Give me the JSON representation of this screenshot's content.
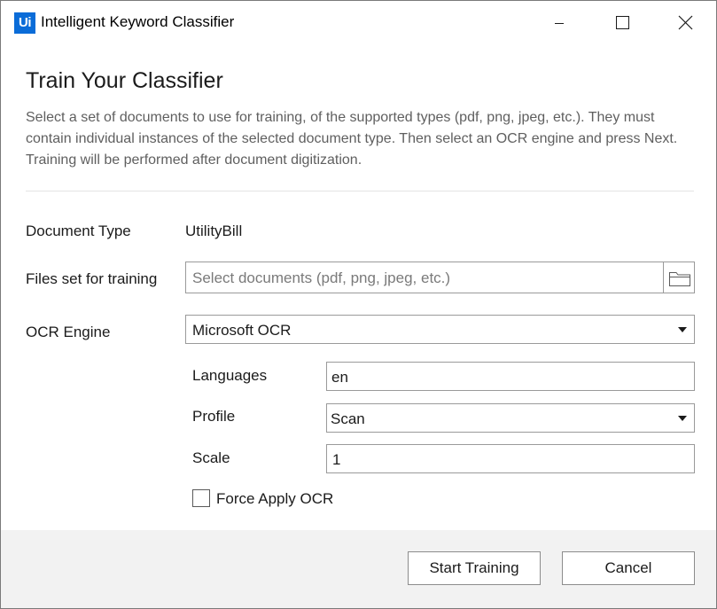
{
  "window": {
    "logo_text": "Ui",
    "title": "Intelligent Keyword Classifier"
  },
  "header": {
    "heading": "Train Your Classifier",
    "description": "Select a set of documents to use for training, of the supported types (pdf, png, jpeg, etc.). They must contain individual instances of the selected document type. Then select an OCR engine and press Next. Training will be performed after document digitization."
  },
  "form": {
    "document_type": {
      "label": "Document Type",
      "value": "UtilityBill"
    },
    "files": {
      "label": "Files set for training",
      "placeholder": "Select documents (pdf, png, jpeg, etc.)"
    },
    "ocr_engine": {
      "label": "OCR Engine",
      "value": "Microsoft OCR"
    },
    "languages": {
      "label": "Languages",
      "value": "en"
    },
    "profile": {
      "label": "Profile",
      "value": "Scan"
    },
    "scale": {
      "label": "Scale",
      "value": "1"
    },
    "force_apply_ocr": {
      "label": "Force Apply OCR",
      "checked": false
    }
  },
  "footer": {
    "start_training_label": "Start Training",
    "cancel_label": "Cancel"
  },
  "colors": {
    "logo_blue": "#0a6cd8",
    "footer_bg": "#f2f2f2",
    "border": "#9a9a9a"
  }
}
